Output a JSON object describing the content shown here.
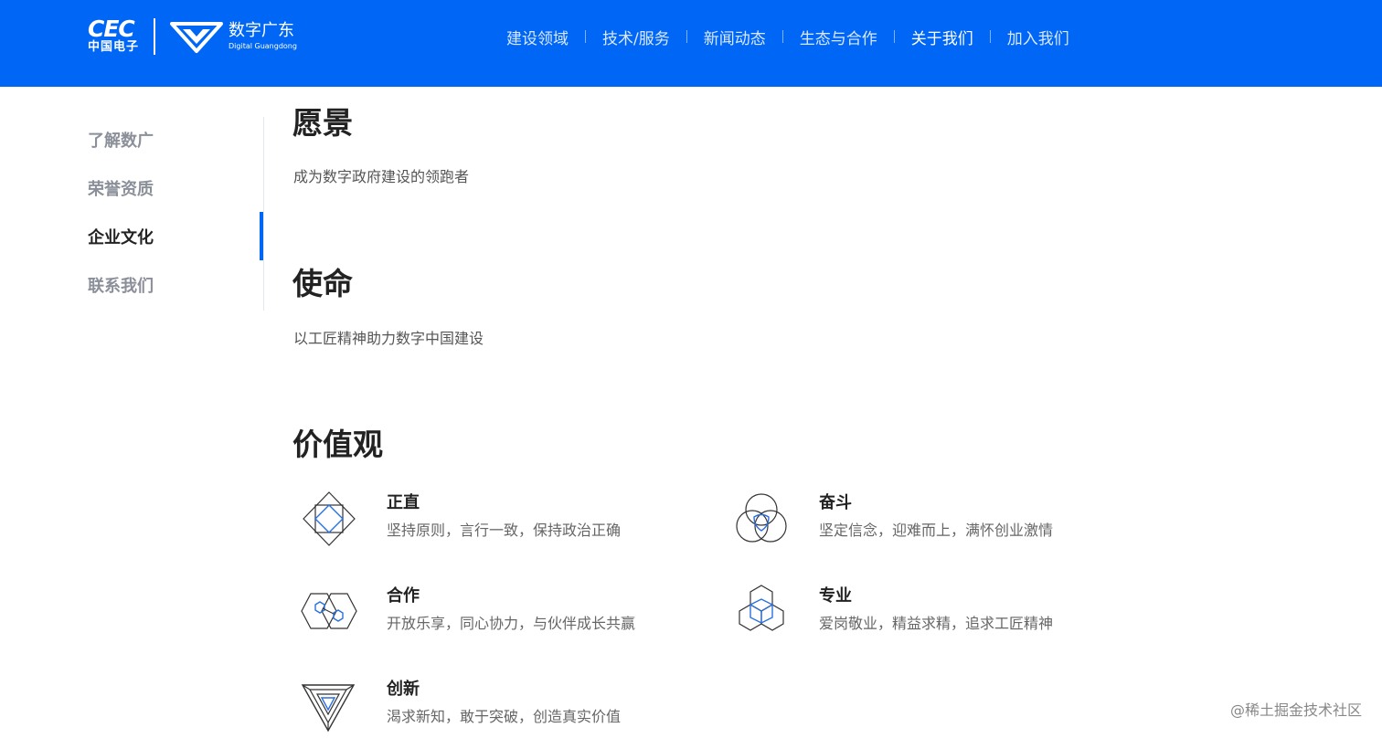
{
  "header": {
    "cec_text": "CEC",
    "cec_sub": "中国电子",
    "brand_cn": "数字广东",
    "brand_en": "Digital Guangdong",
    "bg_color": "#0066f5"
  },
  "nav": {
    "items": [
      {
        "label": "建设领域"
      },
      {
        "label": "技术/服务"
      },
      {
        "label": "新闻动态"
      },
      {
        "label": "生态与合作"
      },
      {
        "label": "关于我们"
      },
      {
        "label": "加入我们"
      }
    ],
    "active": "关于我们"
  },
  "sidebar": {
    "items": [
      {
        "label": "了解数广"
      },
      {
        "label": "荣誉资质"
      },
      {
        "label": "企业文化"
      },
      {
        "label": "联系我们"
      }
    ],
    "active": "企业文化",
    "accent": "#0066f5"
  },
  "vision": {
    "title": "愿景",
    "text": "成为数字政府建设的领跑者"
  },
  "mission": {
    "title": "使命",
    "text": "以工匠精神助力数字中国建设"
  },
  "values": {
    "title": "价值观",
    "items": [
      {
        "icon": "diamond-square-icon",
        "title": "正直",
        "desc": "坚持原则，言行一致，保持政治正确"
      },
      {
        "icon": "three-circles-icon",
        "title": "奋斗",
        "desc": "坚定信念，迎难而上，满怀创业激情"
      },
      {
        "icon": "hexagons-icon",
        "title": "合作",
        "desc": "开放乐享，同心协力，与伙伴成长共赢"
      },
      {
        "icon": "hexagon-cube-icon",
        "title": "专业",
        "desc": "爱岗敬业，精益求精，追求工匠精神"
      },
      {
        "icon": "impossible-triangle-icon",
        "title": "创新",
        "desc": "渴求新知，敢于突破，创造真实价值"
      }
    ]
  },
  "watermark": "@稀土掘金技术社区"
}
